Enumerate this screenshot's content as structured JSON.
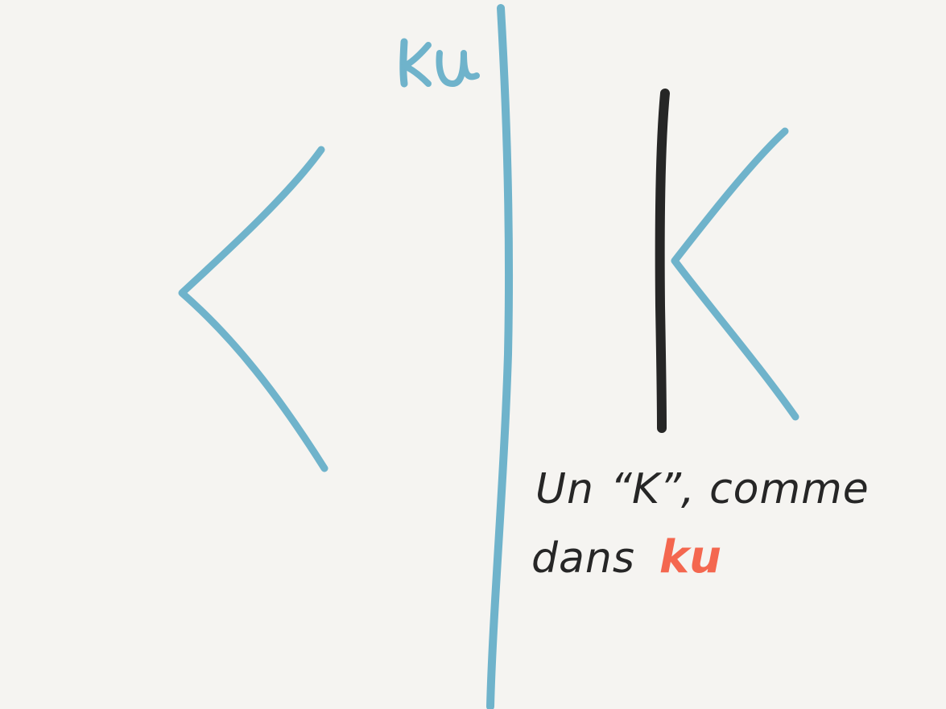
{
  "colors": {
    "background": "#f5f4f1",
    "blue": "#6fb3cb",
    "ink": "#262626",
    "accent": "#f4674f"
  },
  "label_top": "ku",
  "caption": {
    "line1_prefix": "Un",
    "line1_letter": "“K”",
    "line1_suffix": ", comme",
    "line2_prefix": "dans",
    "line2_word": "ku"
  }
}
